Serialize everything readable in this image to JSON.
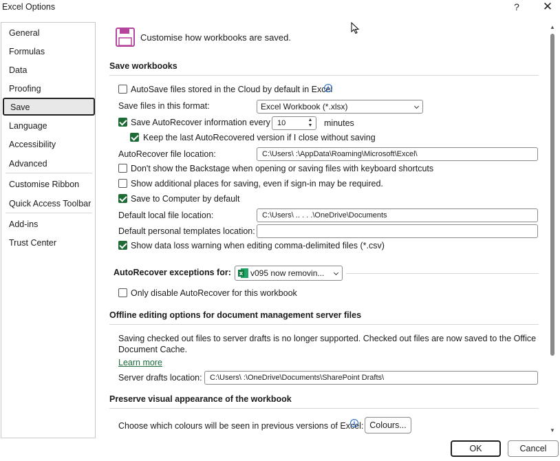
{
  "window": {
    "title": "Excel Options",
    "help_glyph": "?",
    "close_glyph": "✕"
  },
  "sidebar": {
    "items": [
      {
        "label": "General"
      },
      {
        "label": "Formulas"
      },
      {
        "label": "Data"
      },
      {
        "label": "Proofing"
      },
      {
        "label": "Save",
        "selected": true
      },
      {
        "label": "Language"
      },
      {
        "label": "Accessibility"
      },
      {
        "label": "Advanced"
      },
      {
        "label": "Customise Ribbon"
      },
      {
        "label": "Quick Access Toolbar"
      },
      {
        "label": "Add-ins"
      },
      {
        "label": "Trust Center"
      }
    ]
  },
  "header": {
    "icon": "floppy-disk-icon",
    "text": "Customise how workbooks are saved."
  },
  "save_workbooks": {
    "heading": "Save workbooks",
    "autosave_label": "AutoSave files stored in the Cloud by default in Excel",
    "autosave_checked": false,
    "format_label": "Save files in this format:",
    "format_value": "Excel Workbook (*.xlsx)",
    "autorecover_label": "Save AutoRecover information every",
    "autorecover_checked": true,
    "autorecover_minutes": "10",
    "minutes_label": "minutes",
    "keep_last_label": "Keep the last AutoRecovered version if I close without saving",
    "keep_last_checked": true,
    "autorecover_location_label": "AutoRecover file location:",
    "autorecover_location_value": "C:\\Users\\        :\\AppData\\Roaming\\Microsoft\\Excel\\",
    "dont_show_backstage_label": "Don't show the Backstage when opening or saving files with keyboard shortcuts",
    "dont_show_backstage_checked": false,
    "show_additional_label": "Show additional places for saving, even if sign-in may be required.",
    "show_additional_checked": false,
    "save_to_computer_label": "Save to Computer by default",
    "save_to_computer_checked": true,
    "default_local_label": "Default local file location:",
    "default_local_value": "C:\\Users\\ .. . . .\\OneDrive\\Documents",
    "default_templates_label": "Default personal templates location:",
    "default_templates_value": "",
    "data_loss_label": "Show data loss warning when editing comma-delimited files (*.csv)",
    "data_loss_checked": true
  },
  "autorecover_exceptions": {
    "label": "AutoRecover exceptions for:",
    "workbook_value": "v095 now removin...",
    "only_disable_label": "Only disable AutoRecover for this workbook",
    "only_disable_checked": false
  },
  "offline_editing": {
    "heading": "Offline editing options for document management server files",
    "notice": "Saving checked out files to server drafts is no longer supported. Checked out files are now saved to the Office",
    "notice_line2": "Document Cache.",
    "learn_more": "Learn more",
    "server_drafts_label": "Server drafts location:",
    "server_drafts_value": "C:\\Users\\        :\\OneDrive\\Documents\\SharePoint Drafts\\"
  },
  "preserve_visual": {
    "heading": "Preserve visual appearance of the workbook",
    "colours_label": "Choose which colours will be seen in previous versions of Excel:",
    "colours_button": "Colours..."
  },
  "footer": {
    "ok": "OK",
    "cancel": "Cancel"
  },
  "colors": {
    "accent_green": "#1e6b35",
    "link_green": "#1b6b3a",
    "info_blue": "#1a64c8",
    "floppy_purple": "#b4449c"
  }
}
